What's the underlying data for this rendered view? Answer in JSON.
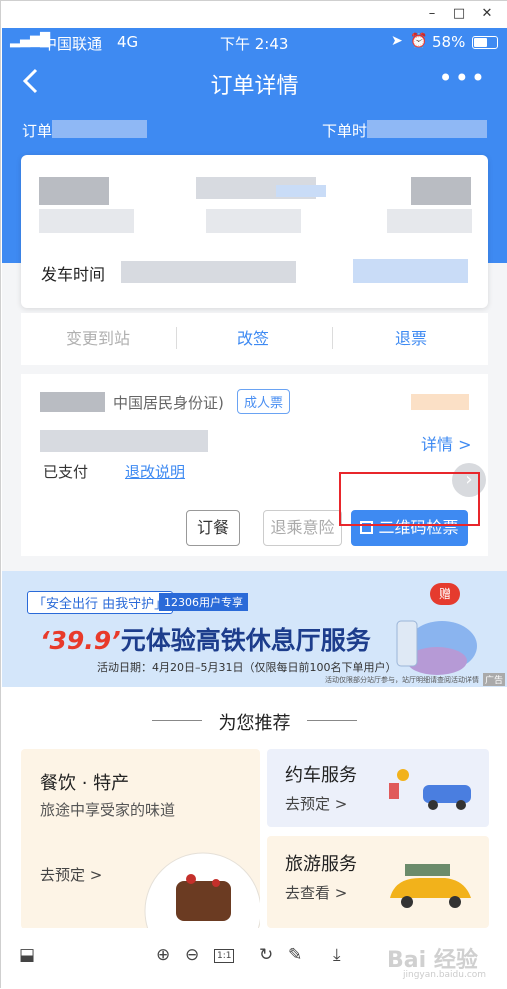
{
  "window": {
    "minimize": "–",
    "maximize": "□",
    "close": "✕"
  },
  "status_bar": {
    "carrier": "中国联通",
    "network": "4G",
    "time": "下午 2:43",
    "battery": "58%"
  },
  "nav": {
    "title": "订单详情",
    "back_icon": "chevron-left-icon",
    "more": "•••"
  },
  "order": {
    "order_no_label": "订单",
    "order_time_label": "下单时"
  },
  "trip": {
    "depart_time_label": "发车时间"
  },
  "actions": {
    "change_station": "变更到站",
    "reschedule": "改签",
    "refund": "退票"
  },
  "passenger": {
    "id_type": "中国居民身份证)",
    "ticket_type": "成人票",
    "detail_link": "详情 >",
    "pay_status": "已支付",
    "refund_note": "退改说明"
  },
  "buttons": {
    "meal": "订餐",
    "insurance": "退乘意险",
    "qr_check": "二维码检票"
  },
  "banner": {
    "slogan": "「安全出行 由我守护」",
    "badge": "12306用户专享",
    "price": "‘39.9’",
    "headline": "元体验高铁休息厅服务",
    "date": "活动日期：4月20日–5月31日（仅限每日前100名下单用户）",
    "footnote": "活动仅限部分站厅参与，站厅明细请查阅活动详情",
    "ad_label": "广告",
    "gift": "赠"
  },
  "recommend": {
    "title": "为您推荐",
    "food": {
      "title": "餐饮 · 特产",
      "subtitle": "旅途中享受家的味道",
      "action": "去预定 >"
    },
    "car": {
      "title": "约车服务",
      "action": "去预定 >"
    },
    "travel": {
      "title": "旅游服务",
      "action": "去查看 >"
    }
  },
  "toolbar": {
    "layout_icon": "⬓",
    "zoom_in": "⊕",
    "zoom_out": "⊖",
    "actual_size": "1:1",
    "rotate": "↻",
    "edit": "✎",
    "download": "⤓"
  },
  "watermark": {
    "text": "Bai 经验",
    "sub": "jingyan.baidu.com"
  },
  "colors": {
    "primary": "#3e8af2",
    "highlight": "#e8262b",
    "banner_red": "#e83a2a"
  }
}
